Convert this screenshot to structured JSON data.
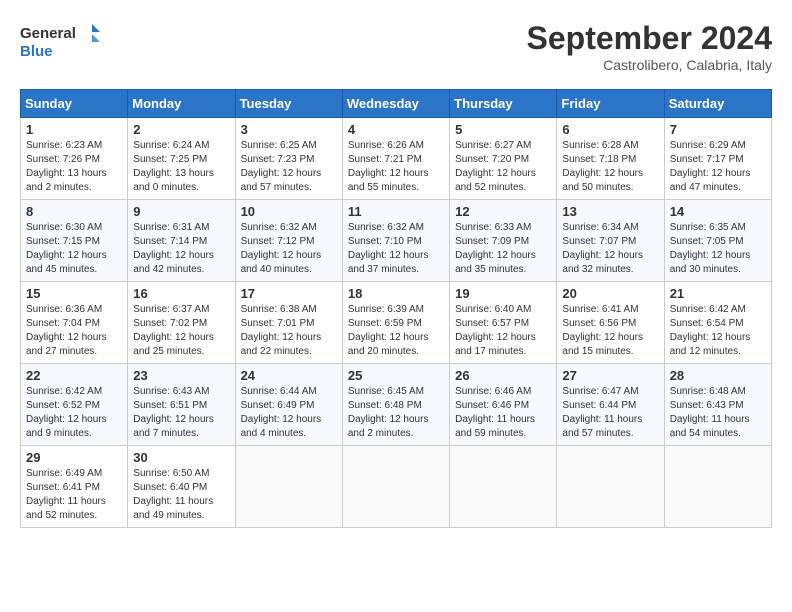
{
  "header": {
    "logo_line1": "General",
    "logo_line2": "Blue",
    "month": "September 2024",
    "location": "Castrolibero, Calabria, Italy"
  },
  "weekdays": [
    "Sunday",
    "Monday",
    "Tuesday",
    "Wednesday",
    "Thursday",
    "Friday",
    "Saturday"
  ],
  "weeks": [
    [
      {
        "day": "1",
        "info": "Sunrise: 6:23 AM\nSunset: 7:26 PM\nDaylight: 13 hours\nand 2 minutes."
      },
      {
        "day": "2",
        "info": "Sunrise: 6:24 AM\nSunset: 7:25 PM\nDaylight: 13 hours\nand 0 minutes."
      },
      {
        "day": "3",
        "info": "Sunrise: 6:25 AM\nSunset: 7:23 PM\nDaylight: 12 hours\nand 57 minutes."
      },
      {
        "day": "4",
        "info": "Sunrise: 6:26 AM\nSunset: 7:21 PM\nDaylight: 12 hours\nand 55 minutes."
      },
      {
        "day": "5",
        "info": "Sunrise: 6:27 AM\nSunset: 7:20 PM\nDaylight: 12 hours\nand 52 minutes."
      },
      {
        "day": "6",
        "info": "Sunrise: 6:28 AM\nSunset: 7:18 PM\nDaylight: 12 hours\nand 50 minutes."
      },
      {
        "day": "7",
        "info": "Sunrise: 6:29 AM\nSunset: 7:17 PM\nDaylight: 12 hours\nand 47 minutes."
      }
    ],
    [
      {
        "day": "8",
        "info": "Sunrise: 6:30 AM\nSunset: 7:15 PM\nDaylight: 12 hours\nand 45 minutes."
      },
      {
        "day": "9",
        "info": "Sunrise: 6:31 AM\nSunset: 7:14 PM\nDaylight: 12 hours\nand 42 minutes."
      },
      {
        "day": "10",
        "info": "Sunrise: 6:32 AM\nSunset: 7:12 PM\nDaylight: 12 hours\nand 40 minutes."
      },
      {
        "day": "11",
        "info": "Sunrise: 6:32 AM\nSunset: 7:10 PM\nDaylight: 12 hours\nand 37 minutes."
      },
      {
        "day": "12",
        "info": "Sunrise: 6:33 AM\nSunset: 7:09 PM\nDaylight: 12 hours\nand 35 minutes."
      },
      {
        "day": "13",
        "info": "Sunrise: 6:34 AM\nSunset: 7:07 PM\nDaylight: 12 hours\nand 32 minutes."
      },
      {
        "day": "14",
        "info": "Sunrise: 6:35 AM\nSunset: 7:05 PM\nDaylight: 12 hours\nand 30 minutes."
      }
    ],
    [
      {
        "day": "15",
        "info": "Sunrise: 6:36 AM\nSunset: 7:04 PM\nDaylight: 12 hours\nand 27 minutes."
      },
      {
        "day": "16",
        "info": "Sunrise: 6:37 AM\nSunset: 7:02 PM\nDaylight: 12 hours\nand 25 minutes."
      },
      {
        "day": "17",
        "info": "Sunrise: 6:38 AM\nSunset: 7:01 PM\nDaylight: 12 hours\nand 22 minutes."
      },
      {
        "day": "18",
        "info": "Sunrise: 6:39 AM\nSunset: 6:59 PM\nDaylight: 12 hours\nand 20 minutes."
      },
      {
        "day": "19",
        "info": "Sunrise: 6:40 AM\nSunset: 6:57 PM\nDaylight: 12 hours\nand 17 minutes."
      },
      {
        "day": "20",
        "info": "Sunrise: 6:41 AM\nSunset: 6:56 PM\nDaylight: 12 hours\nand 15 minutes."
      },
      {
        "day": "21",
        "info": "Sunrise: 6:42 AM\nSunset: 6:54 PM\nDaylight: 12 hours\nand 12 minutes."
      }
    ],
    [
      {
        "day": "22",
        "info": "Sunrise: 6:42 AM\nSunset: 6:52 PM\nDaylight: 12 hours\nand 9 minutes."
      },
      {
        "day": "23",
        "info": "Sunrise: 6:43 AM\nSunset: 6:51 PM\nDaylight: 12 hours\nand 7 minutes."
      },
      {
        "day": "24",
        "info": "Sunrise: 6:44 AM\nSunset: 6:49 PM\nDaylight: 12 hours\nand 4 minutes."
      },
      {
        "day": "25",
        "info": "Sunrise: 6:45 AM\nSunset: 6:48 PM\nDaylight: 12 hours\nand 2 minutes."
      },
      {
        "day": "26",
        "info": "Sunrise: 6:46 AM\nSunset: 6:46 PM\nDaylight: 11 hours\nand 59 minutes."
      },
      {
        "day": "27",
        "info": "Sunrise: 6:47 AM\nSunset: 6:44 PM\nDaylight: 11 hours\nand 57 minutes."
      },
      {
        "day": "28",
        "info": "Sunrise: 6:48 AM\nSunset: 6:43 PM\nDaylight: 11 hours\nand 54 minutes."
      }
    ],
    [
      {
        "day": "29",
        "info": "Sunrise: 6:49 AM\nSunset: 6:41 PM\nDaylight: 11 hours\nand 52 minutes."
      },
      {
        "day": "30",
        "info": "Sunrise: 6:50 AM\nSunset: 6:40 PM\nDaylight: 11 hours\nand 49 minutes."
      },
      {
        "day": "",
        "info": ""
      },
      {
        "day": "",
        "info": ""
      },
      {
        "day": "",
        "info": ""
      },
      {
        "day": "",
        "info": ""
      },
      {
        "day": "",
        "info": ""
      }
    ]
  ]
}
